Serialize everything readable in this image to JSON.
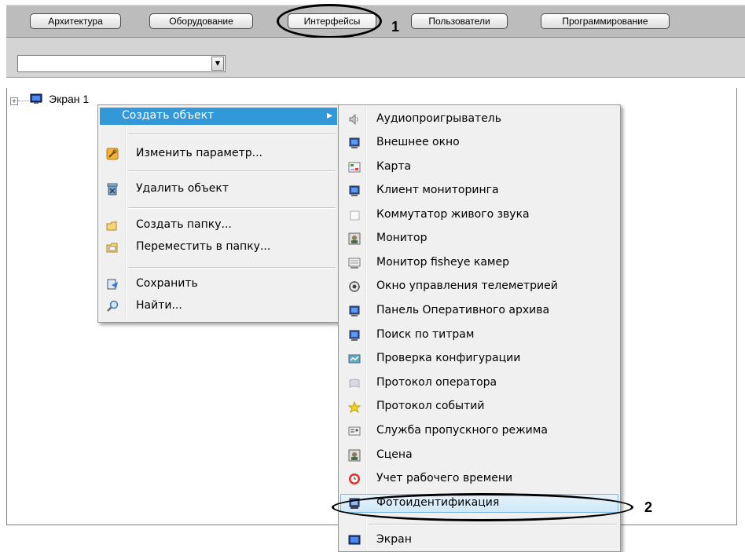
{
  "tabs": [
    {
      "label": "Архитектура"
    },
    {
      "label": "Оборудование"
    },
    {
      "label": "Интерфейсы"
    },
    {
      "label": "Пользователи"
    },
    {
      "label": "Программирование"
    }
  ],
  "callouts": {
    "one": "1",
    "two": "2"
  },
  "combo": {
    "value": "",
    "arrow": "▼"
  },
  "tree": {
    "expander": "+",
    "item_label": "Экран 1"
  },
  "context_menu": {
    "items": [
      {
        "label": "Создать объект",
        "icon": "none",
        "submenu_arrow": "▸"
      },
      {
        "label": "Изменить параметр...",
        "icon": "wrench-icon"
      },
      {
        "label": "Удалить объект",
        "icon": "delete-icon"
      },
      {
        "label": "Создать папку...",
        "icon": "new-folder-icon"
      },
      {
        "label": "Переместить в папку...",
        "icon": "move-folder-icon"
      },
      {
        "label": "Сохранить",
        "icon": "save-icon"
      },
      {
        "label": "Найти...",
        "icon": "magnifier-icon"
      }
    ]
  },
  "submenu": {
    "items": [
      {
        "label": "Аудиопроигрыватель",
        "icon": "speaker-icon"
      },
      {
        "label": "Внешнее окно",
        "icon": "monitor-icon"
      },
      {
        "label": "Карта",
        "icon": "map-icon"
      },
      {
        "label": "Клиент мониторинга",
        "icon": "monitor-icon"
      },
      {
        "label": "Коммутатор живого звука",
        "icon": "blank-icon"
      },
      {
        "label": "Монитор",
        "icon": "camera-monitor-icon"
      },
      {
        "label": "Монитор fisheye камер",
        "icon": "fisheye-icon"
      },
      {
        "label": "Окно управления телеметрией",
        "icon": "telemetry-icon"
      },
      {
        "label": "Панель Оперативного архива",
        "icon": "monitor-icon"
      },
      {
        "label": "Поиск по титрам",
        "icon": "monitor-icon"
      },
      {
        "label": "Проверка конфигурации",
        "icon": "check-config-icon"
      },
      {
        "label": "Протокол оператора",
        "icon": "operator-log-icon"
      },
      {
        "label": "Протокол событий",
        "icon": "event-log-icon"
      },
      {
        "label": "Служба пропускного режима",
        "icon": "access-control-icon"
      },
      {
        "label": "Сцена",
        "icon": "scene-icon"
      },
      {
        "label": "Учет рабочего времени",
        "icon": "clock-icon"
      },
      {
        "label": "Фотоидентификация",
        "icon": "photo-id-icon"
      },
      {
        "label": "Экран",
        "icon": "screen-icon"
      }
    ]
  },
  "colors": {
    "menu_highlight": "#3298d8",
    "tab_bar": "#bcbcbc"
  }
}
